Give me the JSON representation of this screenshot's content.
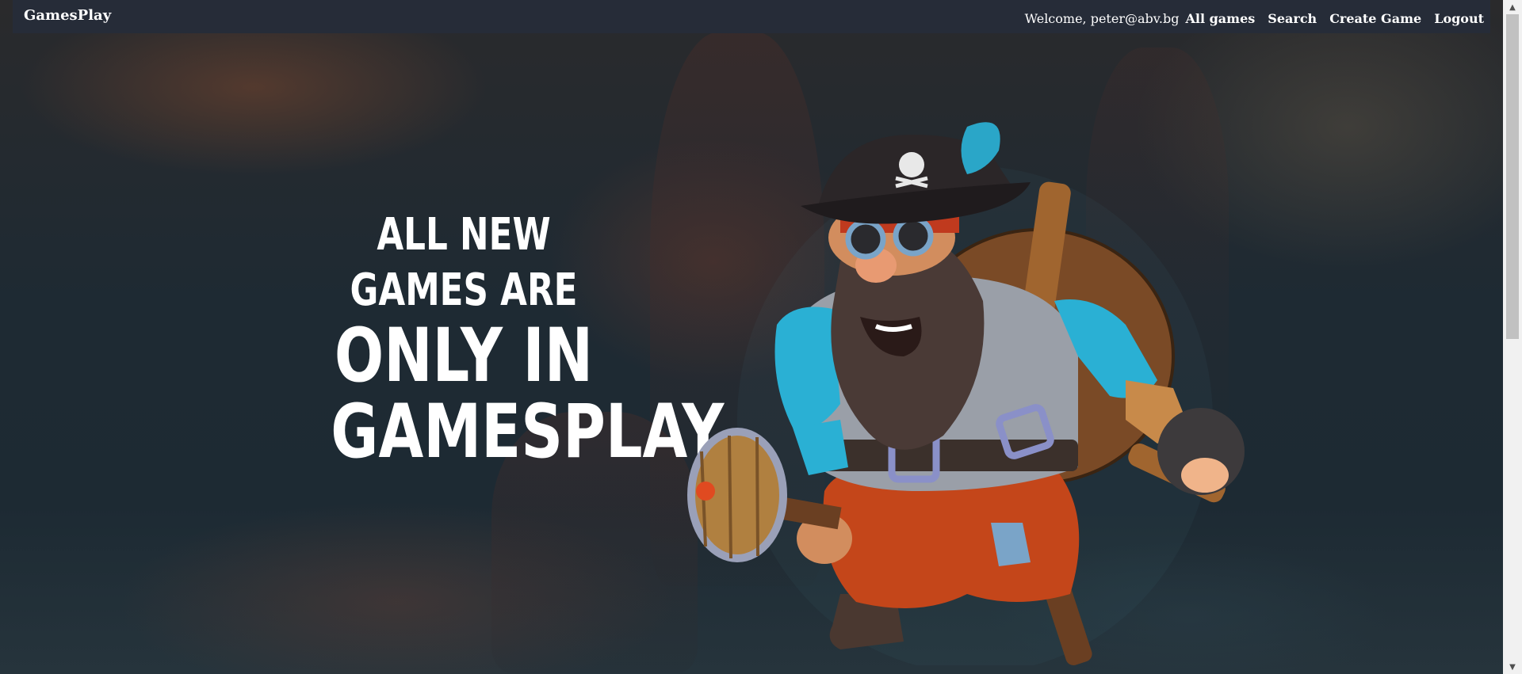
{
  "nav": {
    "brand": "GamesPlay",
    "welcome": "Welcome, peter@abv.bg",
    "links": [
      {
        "label": "All games"
      },
      {
        "label": "Search"
      },
      {
        "label": "Create Game"
      },
      {
        "label": "Logout"
      }
    ]
  },
  "hero": {
    "line1": "ALL NEW GAMES ARE",
    "line2": "ONLY IN",
    "line3": "GAMESPLAY"
  },
  "icons": {
    "hero_image": "pirate-dwarf-character-image",
    "scroll_up": "scroll-up-arrow-icon",
    "scroll_down": "scroll-down-arrow-icon"
  },
  "colors": {
    "navbar": "#262c38",
    "text": "#ffffff",
    "background": "#1e2a33"
  }
}
